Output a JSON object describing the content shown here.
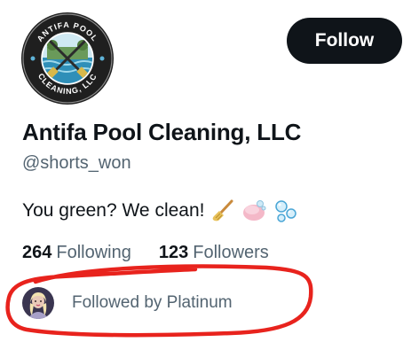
{
  "profile": {
    "display_name": "Antifa Pool Cleaning, LLC",
    "handle": "@shorts_won",
    "bio": "You green? We clean!",
    "avatar_logo_text": "ANTIFA POOL CLEANING, LLC",
    "bio_emojis": [
      "broom",
      "soap",
      "bubbles"
    ]
  },
  "actions": {
    "follow_label": "Follow"
  },
  "stats": {
    "following_count": "264",
    "following_label": "Following",
    "followers_count": "123",
    "followers_label": "Followers"
  },
  "followed_by": {
    "text": "Followed by Platinum"
  },
  "colors": {
    "primary_text": "#0f1419",
    "secondary_text": "#536471",
    "button_bg": "#0f1419",
    "annotation_red": "#e8231d"
  }
}
